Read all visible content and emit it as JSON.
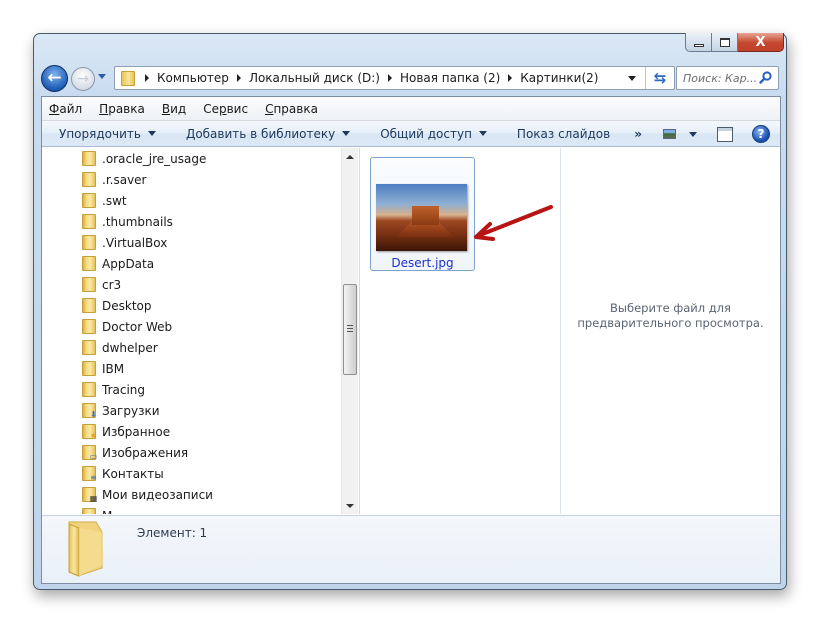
{
  "window": {
    "caption_buttons": {
      "minimize": "minimize-icon",
      "maximize": "maximize-icon",
      "close_label": "X"
    }
  },
  "navigation": {
    "back_icon": "←",
    "forward_icon": "→",
    "breadcrumb": [
      "Компьютер",
      "Локальный диск (D:)",
      "Новая папка (2)",
      "Картинки(2)"
    ],
    "refresh_icon": "⇆",
    "search_placeholder": "Поиск: Кар..."
  },
  "menubar": {
    "items": [
      {
        "accel": "Ф",
        "rest": "айл"
      },
      {
        "accel": "П",
        "rest": "равка"
      },
      {
        "accel": "В",
        "rest": "ид"
      },
      {
        "pre": "Се",
        "accel": "р",
        "rest": "вис"
      },
      {
        "accel": "С",
        "rest": "правка"
      }
    ]
  },
  "commandbar": {
    "organize": "Упорядочить",
    "add_to_library": "Добавить в библиотеку",
    "share": "Общий доступ",
    "slideshow": "Показ слайдов",
    "more": "»",
    "help": "?"
  },
  "tree": {
    "items": [
      {
        "label": ".oracle_jre_usage",
        "icon": "folder"
      },
      {
        "label": ".r.saver",
        "icon": "folder"
      },
      {
        "label": ".swt",
        "icon": "folder"
      },
      {
        "label": ".thumbnails",
        "icon": "folder"
      },
      {
        "label": ".VirtualBox",
        "icon": "folder"
      },
      {
        "label": "AppData",
        "icon": "folder"
      },
      {
        "label": "cr3",
        "icon": "folder"
      },
      {
        "label": "Desktop",
        "icon": "folder"
      },
      {
        "label": "Doctor Web",
        "icon": "folder"
      },
      {
        "label": "dwhelper",
        "icon": "folder"
      },
      {
        "label": "IBM",
        "icon": "folder"
      },
      {
        "label": "Tracing",
        "icon": "folder"
      },
      {
        "label": "Загрузки",
        "icon": "downloads-folder"
      },
      {
        "label": "Избранное",
        "icon": "favorites-folder"
      },
      {
        "label": "Изображения",
        "icon": "pictures-folder"
      },
      {
        "label": "Контакты",
        "icon": "contacts-folder"
      },
      {
        "label": "Мои видеозаписи",
        "icon": "videos-folder"
      },
      {
        "label": "М...",
        "icon": "documents-folder"
      }
    ]
  },
  "files": [
    {
      "name": "Desert.jpg",
      "type": "image"
    }
  ],
  "preview": {
    "message": "Выберите файл для предварительного просмотра."
  },
  "details": {
    "item_count": "Элемент: 1"
  },
  "colors": {
    "file_link": "#1b32c9",
    "annotation_arrow": "#d01818",
    "close_button": "#c5462e"
  }
}
